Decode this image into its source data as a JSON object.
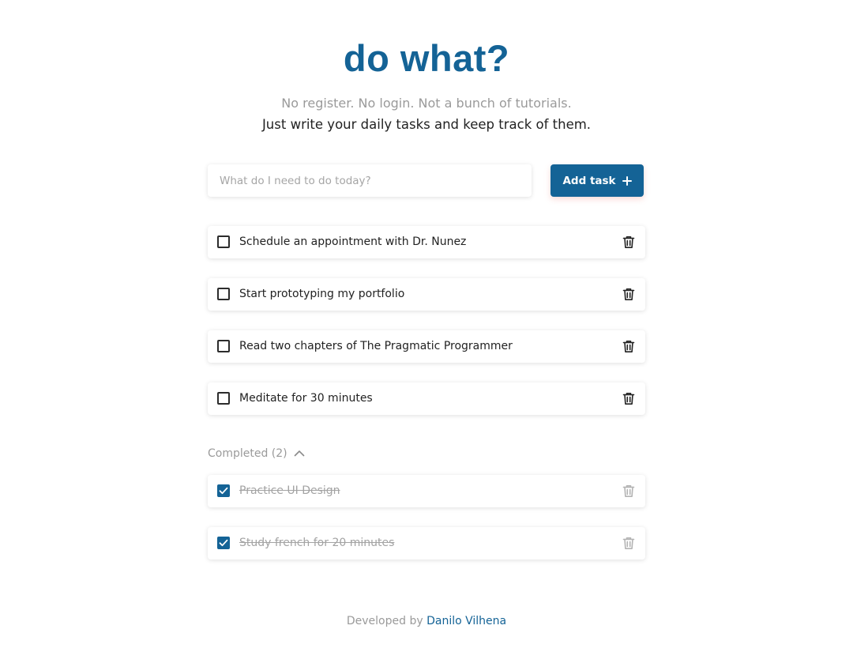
{
  "header": {
    "title": "do what?",
    "subtitle_muted": "No register. No login. Not a bunch of tutorials.",
    "subtitle_main": "Just write your daily tasks and keep track of them."
  },
  "input": {
    "placeholder": "What do I need to do today?",
    "value": ""
  },
  "add_button": {
    "label": "Add task",
    "icon": "plus-icon"
  },
  "tasks": [
    {
      "label": "Schedule an appointment with Dr. Nunez",
      "completed": false
    },
    {
      "label": "Start prototyping my portfolio",
      "completed": false
    },
    {
      "label": "Read two chapters of The Pragmatic Programmer",
      "completed": false
    },
    {
      "label": "Meditate for 30 minutes",
      "completed": false
    }
  ],
  "completed_section": {
    "label": "Completed (2)",
    "expanded": true,
    "icon": "chevron-up-icon",
    "items": [
      {
        "label": "Practice UI Design",
        "completed": true
      },
      {
        "label": "Study french for 20 minutes",
        "completed": true
      }
    ]
  },
  "footer": {
    "prefix": "Developed by",
    "author": "Danilo Vilhena"
  },
  "colors": {
    "accent": "#146396",
    "muted": "#9a9a9a",
    "text": "#222222"
  }
}
